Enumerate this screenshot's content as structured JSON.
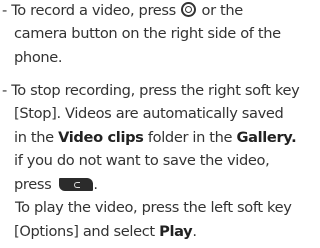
{
  "para1": {
    "l1_a": "- To record a video, press",
    "l1_b": "or the",
    "l2": "camera button on the right side of the",
    "l3": "phone.",
    "record_icon": "record-button-icon"
  },
  "para2": {
    "l1": "- To stop recording, press the right soft key",
    "l2": "[Stop]. Videos are automatically saved",
    "l3_a": "in the",
    "l3_b": "Video clips",
    "l3_c": "folder in the",
    "l3_d": "Gallery.",
    "l4": "if you do not want to save the video,",
    "l5_a": "press",
    "l5_b": ".",
    "clear_icon": "clear-key-icon",
    "l6": "To play the video, press the left soft key",
    "l7_a": "[Options] and select",
    "l7_b": "Play",
    "l7_c": "."
  }
}
